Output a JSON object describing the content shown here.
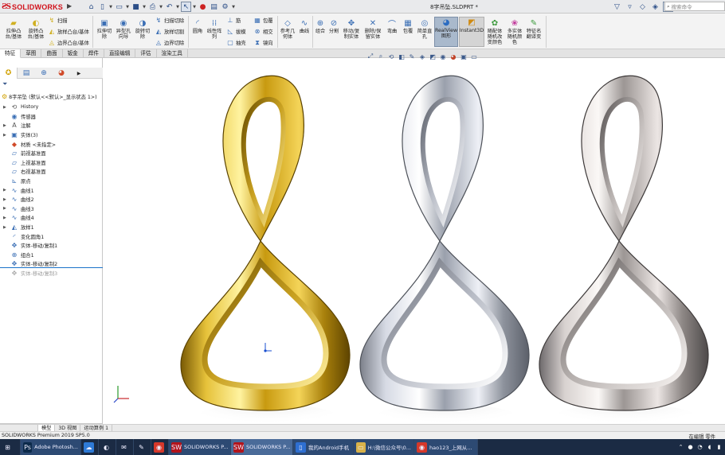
{
  "app": {
    "brand": "SOLIDWORKS",
    "document_title": "8字吊坠.SLDPRT *",
    "search_placeholder": "搜索命令"
  },
  "ribbon": {
    "extrude_boss": "拉伸凸\n台/基体",
    "revolve_boss": "旋转凸\n台/基体",
    "sweep": "扫描",
    "loft_boss": "放样凸台/基体",
    "boundary_boss": "边界凸台/基体",
    "extrude_cut": "拉伸切\n除",
    "hole_wizard": "异型孔\n向导",
    "revolve_cut": "旋转切\n除",
    "swept_cut": "扫描切除",
    "lofted_cut": "放样切割",
    "boundary_cut": "边界切除",
    "fillet": "圆角",
    "linear_pattern": "线性阵\n列",
    "rib": "筋",
    "wrap": "包覆",
    "draft": "拔模",
    "intersect": "相交",
    "shell": "抽壳",
    "mirror": "镜向",
    "ref_geometry": "参考几\n何体",
    "curves": "曲线",
    "combine": "组合",
    "split": "分割",
    "move_copy_body": "移动/复\n制实体",
    "delete_keep_body": "删除/保\n留实体",
    "flex": "弯曲",
    "wrap2": "包覆",
    "simple_hole": "简单直\n孔",
    "realview": "RealView\n图形",
    "instant3d": "Instant3D",
    "random_color": "随配体\n随机改\n变颜色",
    "multibody_color": "多实体\n随机颜\n色",
    "feature_rename": "特征名\n翻译变"
  },
  "command_tabs": [
    "特征",
    "草图",
    "曲面",
    "钣金",
    "焊件",
    "直接编辑",
    "评估",
    "渲染工具"
  ],
  "feature_tree": {
    "root": "8字吊坠  (默认<<默认>_显示状态 1>)",
    "items": [
      {
        "label": "History",
        "icon": "history-icon",
        "expand": true
      },
      {
        "label": "传感器",
        "icon": "sensor-icon",
        "expand": false
      },
      {
        "label": "注解",
        "icon": "annotation-icon",
        "expand": true
      },
      {
        "label": "实体(3)",
        "icon": "solid-bodies-icon",
        "expand": true
      },
      {
        "label": "材质 <未指定>",
        "icon": "material-icon",
        "expand": false
      },
      {
        "label": "前视基准面",
        "icon": "plane-icon",
        "expand": false
      },
      {
        "label": "上视基准面",
        "icon": "plane-icon",
        "expand": false
      },
      {
        "label": "右视基准面",
        "icon": "plane-icon",
        "expand": false
      },
      {
        "label": "原点",
        "icon": "origin-icon",
        "expand": false
      },
      {
        "label": "曲线1",
        "icon": "curve-icon",
        "expand": true
      },
      {
        "label": "曲线2",
        "icon": "curve-icon",
        "expand": true
      },
      {
        "label": "曲线3",
        "icon": "curve-icon",
        "expand": true
      },
      {
        "label": "曲线4",
        "icon": "curve-icon",
        "expand": true
      },
      {
        "label": "放样1",
        "icon": "loft-icon",
        "expand": true
      },
      {
        "label": "变化圆角1",
        "icon": "fillet-icon",
        "expand": false
      },
      {
        "label": "实体-移动/复制1",
        "icon": "move-body-icon",
        "expand": false
      },
      {
        "label": "组合1",
        "icon": "combine-icon",
        "expand": false
      },
      {
        "label": "实体-移动/复制2",
        "icon": "move-body-icon",
        "expand": false
      },
      {
        "label": "实体-移动/复制3",
        "icon": "move-body-icon",
        "expand": false,
        "suppressed": true
      }
    ]
  },
  "model_tabs": [
    "模型",
    "3D 视图",
    "运动算例 1"
  ],
  "status": {
    "left": "SOLIDWORKS Premium 2019 SP5.0",
    "right": "在编辑 零件"
  },
  "taskbar": {
    "items": [
      {
        "label": "",
        "icon": "start-icon"
      },
      {
        "label": "Adobe Photosh...",
        "icon": "photoshop-icon"
      },
      {
        "label": "",
        "icon": "baidu-netdisk-icon"
      },
      {
        "label": "",
        "icon": "video-app-icon"
      },
      {
        "label": "",
        "icon": "wechat-tool-icon"
      },
      {
        "label": "",
        "icon": "paint-icon"
      },
      {
        "label": "",
        "icon": "chrome-icon"
      },
      {
        "label": "SOLIDWORKS P...",
        "icon": "solidworks-icon"
      },
      {
        "label": "SOLIDWORKS P...",
        "icon": "solidworks-icon"
      },
      {
        "label": "我的Android手机",
        "icon": "android-icon"
      },
      {
        "label": "H:\\微信公众号\\0...",
        "icon": "folder-icon"
      },
      {
        "label": "hao123_上网从...",
        "icon": "chrome-icon"
      }
    ]
  },
  "colors": {
    "brand_red": "#d1121b",
    "gold": "#d4a820",
    "silver": "#c8ccd4",
    "taskbar": "#1b2b44"
  }
}
